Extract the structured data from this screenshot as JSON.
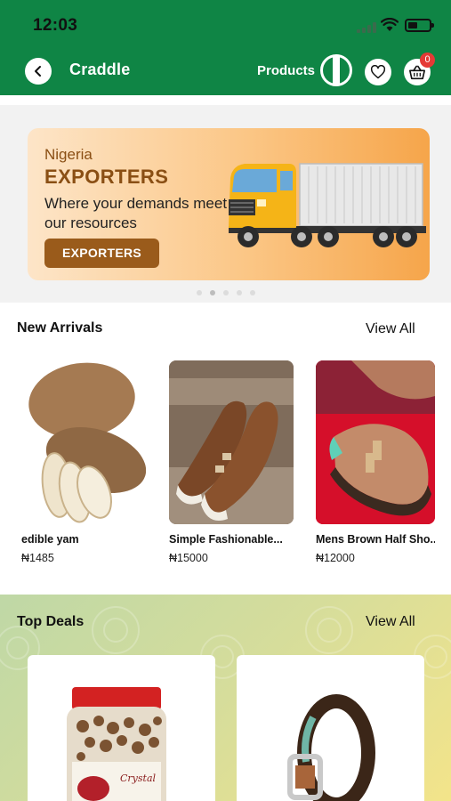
{
  "status_bar": {
    "time": "12:03"
  },
  "header": {
    "title": "Craddle",
    "products_label": "Products",
    "cart_count": "0",
    "colors": {
      "primary": "#0f8545",
      "badge": "#e53935"
    }
  },
  "banner": {
    "line1": "Nigeria",
    "line2": "EXPORTERS",
    "tagline": "Where your demands meet our resources",
    "button_label": "EXPORTERS",
    "slides": 5,
    "active_slide": 2
  },
  "new_arrivals": {
    "title": "New Arrivals",
    "view_all": "View All",
    "items": [
      {
        "name": "edible yam",
        "price": "₦1485"
      },
      {
        "name": "Simple Fashionable...",
        "price": "₦15000"
      },
      {
        "name": "Mens Brown Half Sho...",
        "price": "₦12000"
      }
    ]
  },
  "top_deals": {
    "title": "Top Deals",
    "view_all": "View All",
    "items": [
      {
        "image": "jar-of-snacks"
      },
      {
        "image": "leather-belt"
      }
    ]
  }
}
